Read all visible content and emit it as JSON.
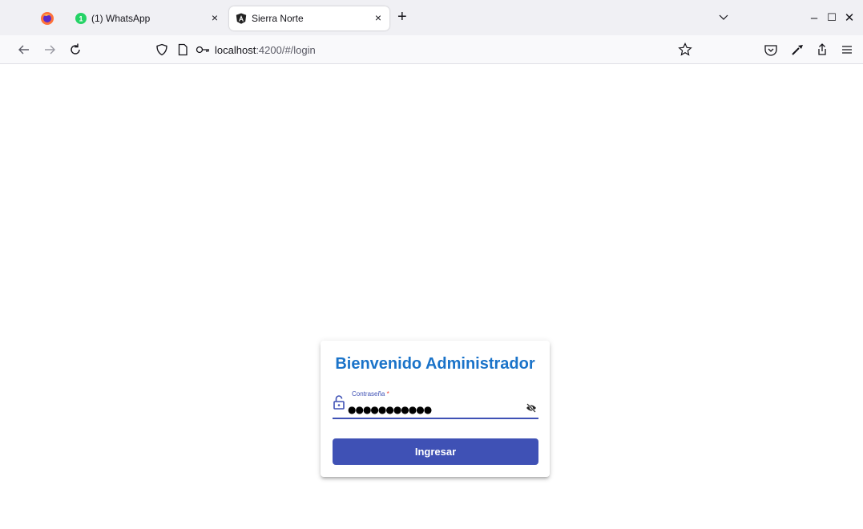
{
  "browser": {
    "tabs": [
      {
        "title": "(1) WhatsApp",
        "badge": "1",
        "active": false
      },
      {
        "title": "Sierra Norte",
        "active": true
      }
    ],
    "tab_close_glyph": "×",
    "new_tab_glyph": "+",
    "url_host": "localhost",
    "url_rest": ":4200/#/login",
    "window": {
      "minimize": "–",
      "maximize": "☐",
      "close": "✕"
    }
  },
  "login": {
    "title": "Bienvenido Administrador",
    "password_label": "Contraseña",
    "required_mark": "*",
    "password_value": "●●●●●●●●●●●",
    "submit_label": "Ingresar"
  },
  "colors": {
    "primary": "#3f51b5",
    "title": "#1a73c9",
    "required": "#f44336",
    "whatsapp": "#25d366"
  },
  "icons": [
    "firefox-icon",
    "whatsapp-icon",
    "angular-icon",
    "back-icon",
    "forward-icon",
    "reload-icon",
    "shield-icon",
    "page-icon",
    "key-icon",
    "bookmark-star-icon",
    "pocket-icon",
    "eyedropper-icon",
    "share-icon",
    "menu-icon",
    "lock-open-icon",
    "visibility-off-icon"
  ]
}
